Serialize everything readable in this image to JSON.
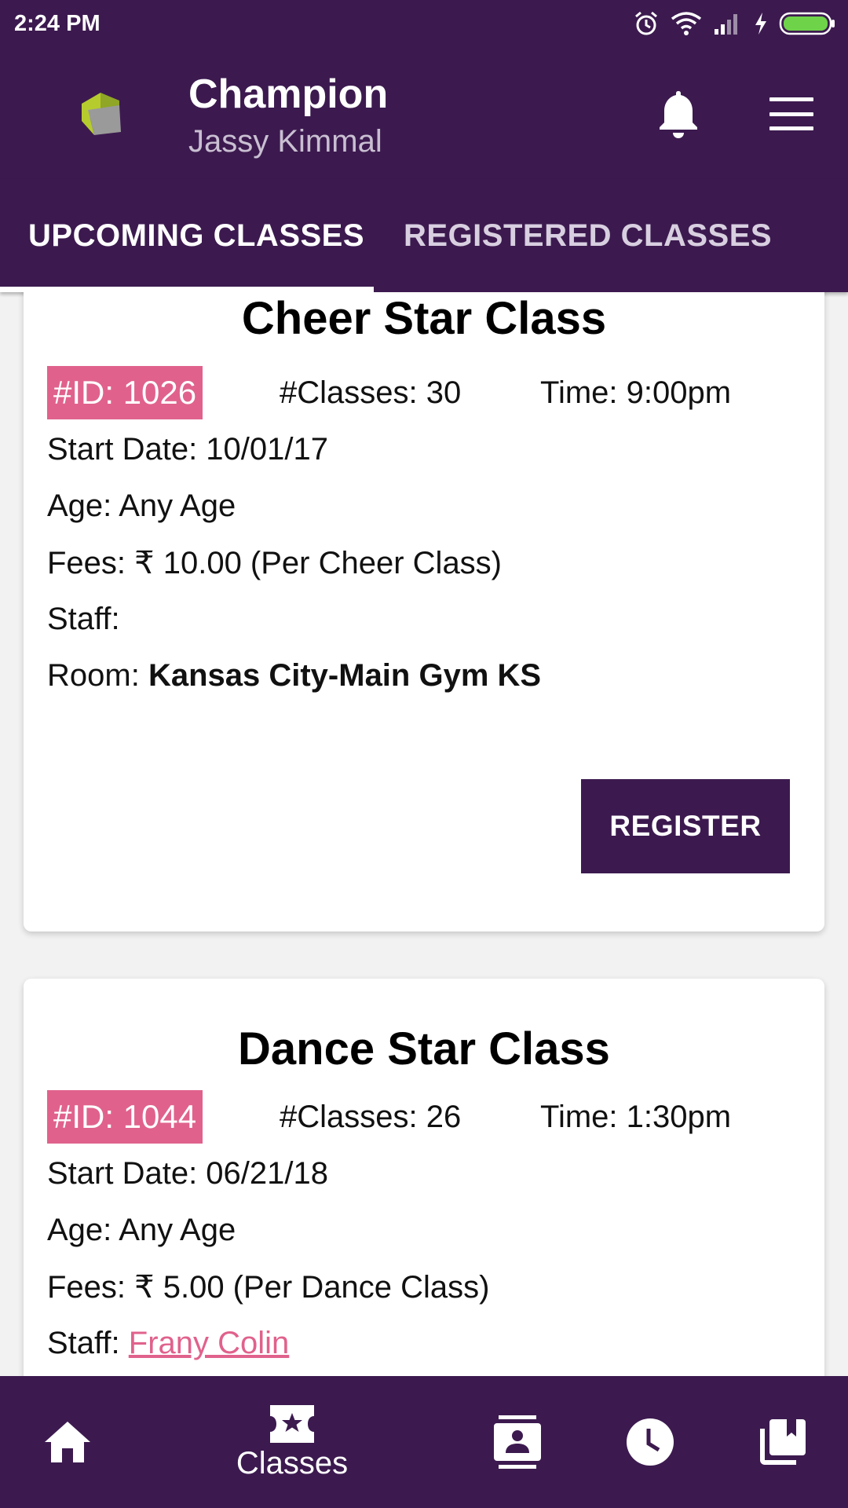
{
  "status_bar": {
    "time": "2:24 PM"
  },
  "header": {
    "title": "Champion",
    "subtitle": "Jassy Kimmal"
  },
  "tabs": [
    {
      "label": "UPCOMING CLASSES",
      "active": true
    },
    {
      "label": "REGISTERED CLASSES",
      "active": false
    }
  ],
  "classes": [
    {
      "title": "Cheer Star Class",
      "id_badge": "#ID:  1026",
      "num_classes": "#Classes: 30",
      "time": "Time: 9:00pm",
      "start_date": "Start Date: 10/01/17",
      "age": "Age: Any Age",
      "fees": "Fees: ₹ 10.00 (Per Cheer Class)",
      "staff_label": "Staff:",
      "room_label": "Room:",
      "room_value": "Kansas City-Main Gym KS",
      "register_label": "REGISTER"
    },
    {
      "title": "Dance Star Class",
      "id_badge": "#ID:  1044",
      "num_classes": "#Classes: 26",
      "time": "Time: 1:30pm",
      "start_date": "Start Date: 06/21/18",
      "age": "Age: Any Age",
      "fees": "Fees: ₹ 5.00 (Per Dance Class)",
      "staff_label": "Staff:",
      "staff_name": "Frany Colin"
    }
  ],
  "bottom_nav": [
    {
      "icon": "home-icon",
      "label": ""
    },
    {
      "icon": "ticket-star-icon",
      "label": "Classes",
      "active": true
    },
    {
      "icon": "contacts-icon",
      "label": ""
    },
    {
      "icon": "clock-icon",
      "label": ""
    },
    {
      "icon": "library-books-icon",
      "label": ""
    }
  ],
  "colors": {
    "primary": "#3c1a4f",
    "accent": "#e0628c"
  }
}
